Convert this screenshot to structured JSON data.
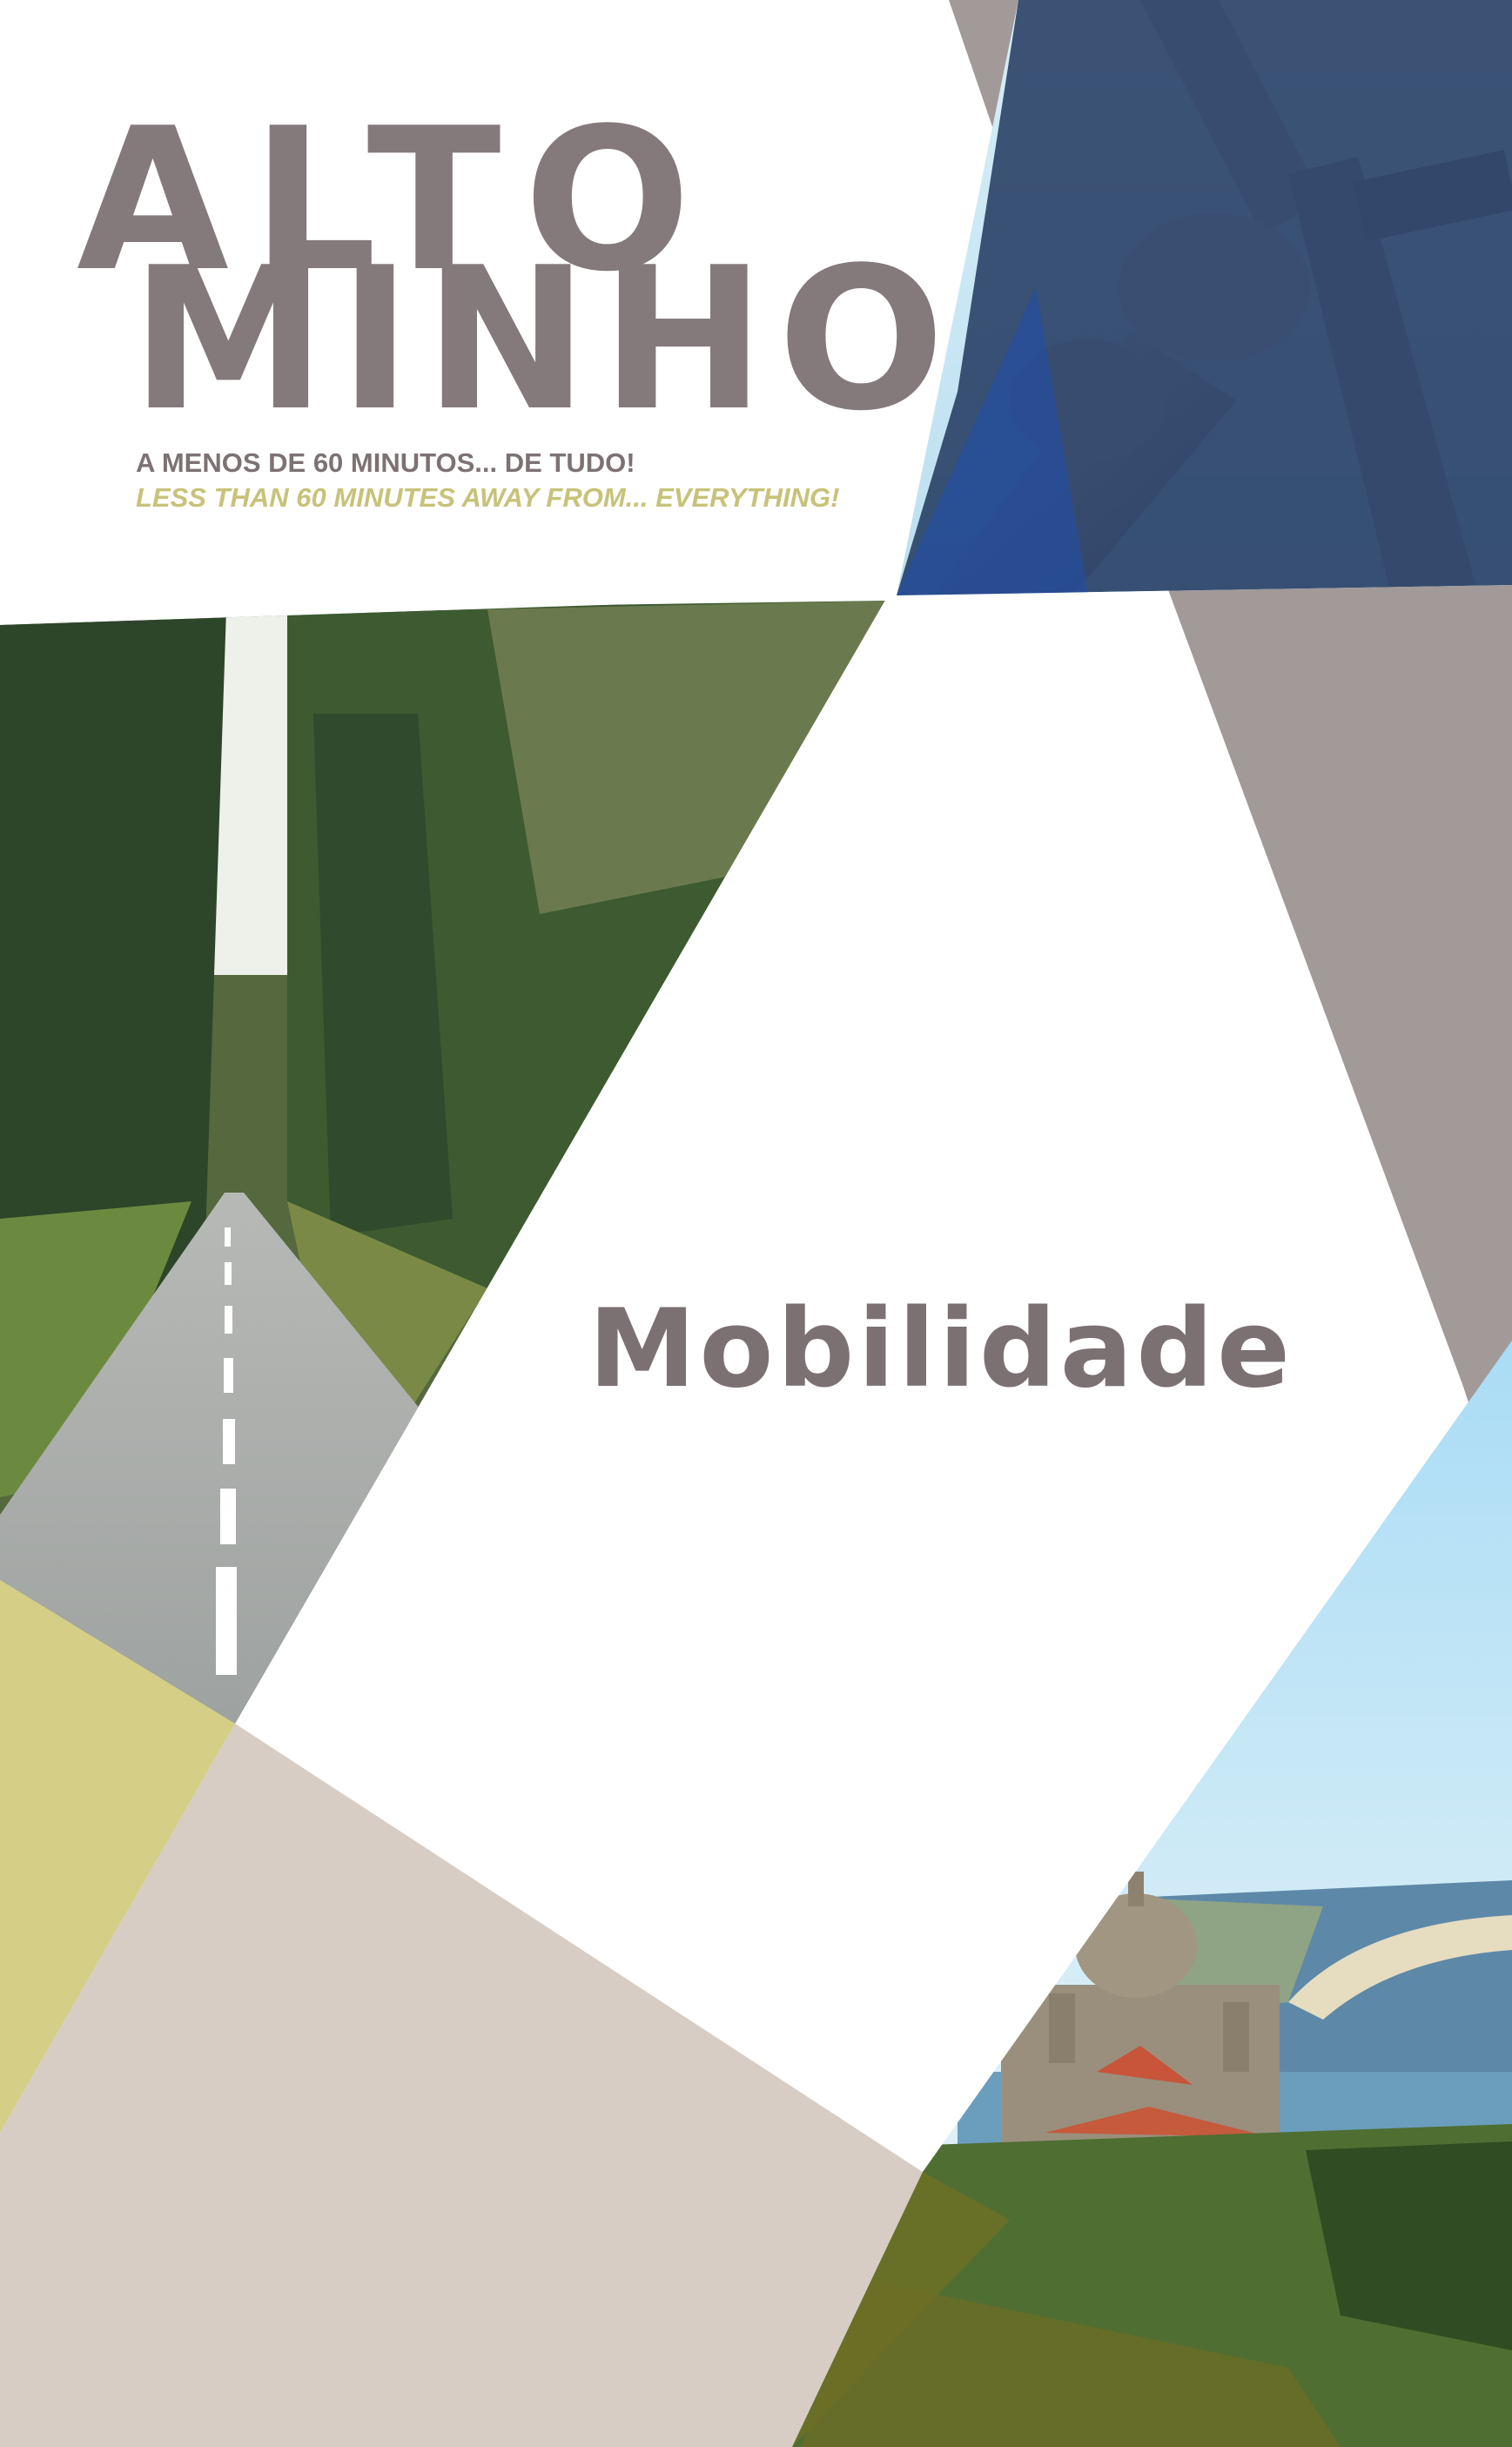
{
  "cover": {
    "logo": {
      "line1": "ALTO",
      "line2": "MINHO"
    },
    "tagline_pt": "A MENOS DE 60 MINUTOS... DE TUDO!",
    "tagline_en": "LESS THAN 60 MINUTES AWAY FROM... EVERYTHING!",
    "title": "Mobilidade"
  },
  "colors": {
    "logo_grey": "#847a7b",
    "tagline_en": "#c8c27a",
    "grey_shape": "#a29999",
    "olive_shape": "#d4ce87",
    "beige_shape": "#d7cdc4",
    "navy_overlay": "#10274f",
    "sky": "#bfe3f3"
  },
  "images": [
    {
      "name": "wind-turbine-photo"
    },
    {
      "name": "forest-road-photo"
    },
    {
      "name": "santa-luzia-sanctuary-photo"
    }
  ]
}
